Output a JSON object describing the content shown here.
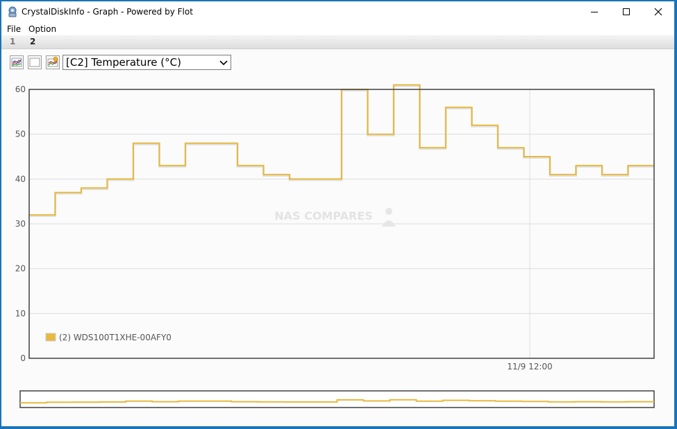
{
  "window": {
    "title": "CrystalDiskInfo - Graph - Powered by Flot"
  },
  "menu": {
    "file": "File",
    "option": "Option"
  },
  "tabs": [
    {
      "label": "1"
    },
    {
      "label": "2"
    }
  ],
  "toolbar": {
    "buttons": [
      {
        "icon": "graph-all-icon"
      },
      {
        "icon": "graph-none-icon"
      },
      {
        "icon": "graph-reset-icon"
      }
    ],
    "attribute_select": {
      "value": "[C2] Temperature (°C)"
    }
  },
  "watermark": "NAS COMPARES",
  "colors": {
    "series": "#e7b93f",
    "window_border": "#1a73b8",
    "frame": "#404040"
  },
  "chart_data": {
    "type": "line",
    "step": true,
    "ylim": [
      0,
      60
    ],
    "yticks": [
      0,
      10,
      20,
      30,
      40,
      50,
      60
    ],
    "xtick_labels": [
      "11/9 12:00"
    ],
    "grid": true,
    "legend_position": "bottom-left",
    "series": [
      {
        "name": "(2) WDS100T1XHE-00AFY0",
        "values": [
          32,
          37,
          38,
          40,
          48,
          43,
          48,
          48,
          43,
          41,
          40,
          40,
          60,
          50,
          61,
          47,
          56,
          52,
          47,
          45,
          41,
          43,
          41,
          43
        ]
      }
    ]
  }
}
